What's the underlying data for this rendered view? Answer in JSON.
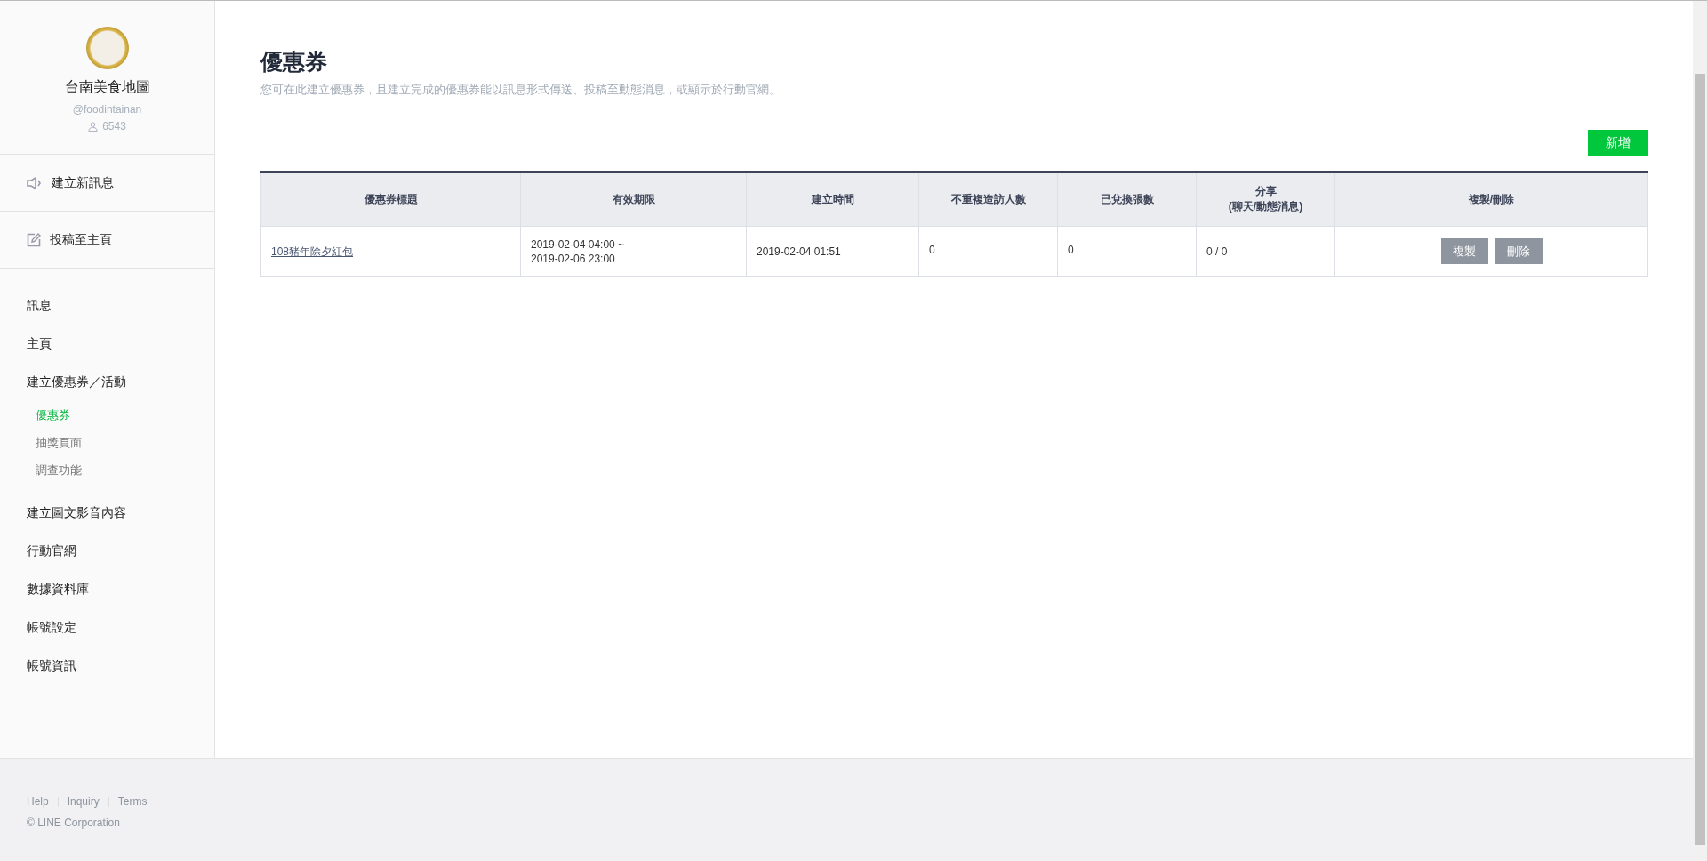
{
  "account": {
    "name": "台南美食地圖",
    "handle": "@foodintainan",
    "followers": "6543"
  },
  "actions": [
    {
      "label": "建立新訊息",
      "kind": "message"
    },
    {
      "label": "投稿至主頁",
      "kind": "post"
    }
  ],
  "sidebar": {
    "items": [
      {
        "label": "訊息",
        "kind": "main",
        "selected": false
      },
      {
        "label": "主頁",
        "kind": "main",
        "selected": false
      },
      {
        "label": "建立優惠券／活動",
        "kind": "main",
        "selected": false
      },
      {
        "label": "優惠券",
        "kind": "sub",
        "selected": true
      },
      {
        "label": "抽獎頁面",
        "kind": "sub",
        "selected": false
      },
      {
        "label": "調查功能",
        "kind": "sub",
        "selected": false
      },
      {
        "label": "建立圖文影音內容",
        "kind": "main",
        "selected": false
      },
      {
        "label": "行動官網",
        "kind": "main",
        "selected": false
      },
      {
        "label": "數據資料庫",
        "kind": "main",
        "selected": false
      },
      {
        "label": "帳號設定",
        "kind": "main",
        "selected": false
      },
      {
        "label": "帳號資訊",
        "kind": "main",
        "selected": false
      }
    ]
  },
  "page": {
    "title": "優惠券",
    "description": "您可在此建立優惠券，且建立完成的優惠券能以訊息形式傳送、投稿至動態消息，或顯示於行動官網。",
    "add_button": "新增"
  },
  "table": {
    "columns": [
      "優惠券標題",
      "有效期限",
      "建立時間",
      "不重複造訪人數",
      "已兌換張數",
      "分享\n(聊天/動態消息)",
      "複製/刪除"
    ],
    "rows": [
      {
        "title": "108豬年除夕紅包",
        "validity": [
          "2019-02-04 04:00 ~",
          "2019-02-06 23:00"
        ],
        "created": "2019-02-04 01:51",
        "visitors": "0",
        "redeemed": "0",
        "shares": "0 / 0",
        "copy": "複製",
        "delete": "刪除"
      }
    ]
  },
  "footer": {
    "links": [
      "Help",
      "Inquiry",
      "Terms"
    ],
    "copyright": "© LINE Corporation"
  }
}
